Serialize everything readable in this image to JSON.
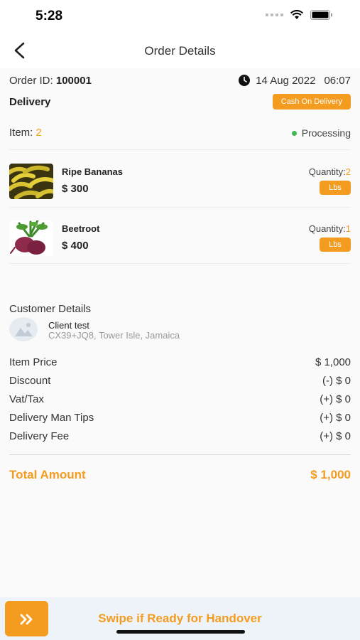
{
  "status": {
    "time": "5:28"
  },
  "header": {
    "title": "Order Details"
  },
  "order": {
    "id_label": "Order ID:",
    "id_value": "100001",
    "date": "14 Aug 2022",
    "time": "06:07",
    "type": "Delivery",
    "payment": "Cash On Delivery",
    "items_label": "Item:",
    "items_count": "2",
    "status": "Processing"
  },
  "items": [
    {
      "name": "Ripe Bananas",
      "price": "$ 300",
      "qty_label": "Quantity:",
      "qty": "2",
      "unit": "Lbs"
    },
    {
      "name": "Beetroot",
      "price": "$ 400",
      "qty_label": "Quantity:",
      "qty": "1",
      "unit": "Lbs"
    }
  ],
  "customer": {
    "section_title": "Customer Details",
    "name": "Client test",
    "address": "CX39+JQ8, Tower Isle, Jamaica"
  },
  "summary": [
    {
      "label": "Item Price",
      "value": "$ 1,000"
    },
    {
      "label": "Discount",
      "value": "(-) $ 0"
    },
    {
      "label": "Vat/Tax",
      "value": "(+) $ 0"
    },
    {
      "label": "Delivery Man Tips",
      "value": "(+) $ 0"
    },
    {
      "label": "Delivery Fee",
      "value": "(+) $ 0"
    }
  ],
  "total": {
    "label": "Total Amount",
    "value": "$ 1,000"
  },
  "swipe": {
    "label": "Swipe if Ready for Handover",
    "icon": "double-chevron-right"
  },
  "colors": {
    "accent": "#f39c1f",
    "status_green": "#3fb950"
  }
}
